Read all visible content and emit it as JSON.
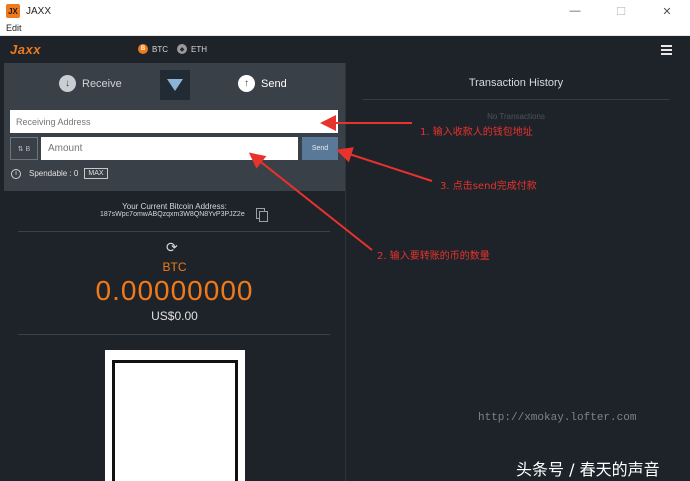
{
  "window": {
    "icon_text": "JX",
    "title": "JAXX",
    "minimize": "—",
    "maximize": "☐",
    "close": "✕"
  },
  "menu": {
    "edit": "Edit"
  },
  "header": {
    "logo": "Jaxx",
    "coins": [
      {
        "symbol": "B",
        "label": "BTC"
      },
      {
        "symbol": "◆",
        "label": "ETH"
      }
    ]
  },
  "wallet": {
    "receive_label": "Receive",
    "send_label": "Send",
    "address_placeholder": "Receiving Address",
    "unit_label": "⇅ B",
    "amount_placeholder": "Amount",
    "send_button": "Send",
    "spendable_label": "Spendable : 0",
    "max_button": "MAX",
    "current_address_label": "Your Current Bitcoin Address:",
    "current_address": "187sWpc7omwABQzqxm3W8QN8YvP3PJZ2e",
    "balance_coin": "BTC",
    "balance_value": "0.00000000",
    "balance_fiat": "US$0.00"
  },
  "history": {
    "title": "Transaction History",
    "empty": "No Transactions"
  },
  "annotations": [
    {
      "text": "1. 输入收款人的钱包地址"
    },
    {
      "text": "3. 点击send完成付款"
    },
    {
      "text": "2. 输入要转账的币的数量"
    }
  ],
  "watermark": "http://xmokay.lofter.com",
  "credit": "头条号 / 春天的声音",
  "colors": {
    "accent": "#f07a1a",
    "background": "#1e2329",
    "panel": "#3a4048",
    "send_button": "#5a7898",
    "annotation": "#e8322d"
  }
}
